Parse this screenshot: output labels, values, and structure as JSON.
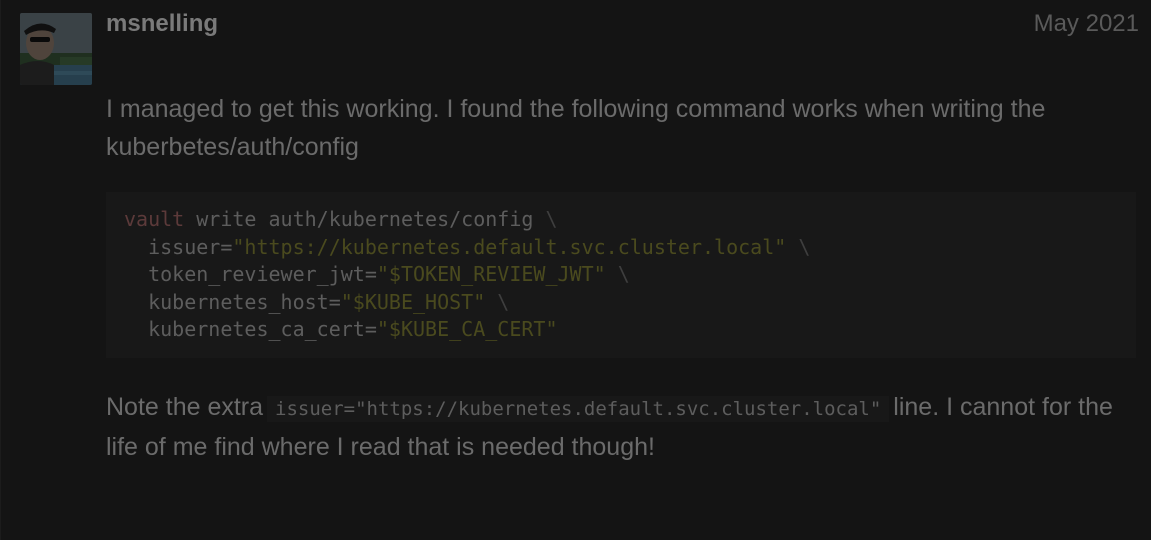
{
  "post": {
    "username": "msnelling",
    "date": "May 2021",
    "paragraph1": "I managed to get this working. I found the following command works when writing the kuberbetes/auth/config",
    "code_lines": [
      {
        "indent": "",
        "cmd": "vault",
        "text": " write auth/kubernetes/config ",
        "str": "",
        "cont": "\\"
      },
      {
        "indent": "  ",
        "cmd": "",
        "text": "issuer=",
        "str": "\"https://kubernetes.default.svc.cluster.local\"",
        "cont": " \\"
      },
      {
        "indent": "  ",
        "cmd": "",
        "text": "token_reviewer_jwt=",
        "str": "\"$TOKEN_REVIEW_JWT\"",
        "cont": " \\"
      },
      {
        "indent": "  ",
        "cmd": "",
        "text": "kubernetes_host=",
        "str": "\"$KUBE_HOST\"",
        "cont": " \\"
      },
      {
        "indent": "  ",
        "cmd": "",
        "text": "kubernetes_ca_cert=",
        "str": "\"$KUBE_CA_CERT\"",
        "cont": ""
      }
    ],
    "paragraph2_before": "Note the extra",
    "paragraph2_code": "issuer=\"https://kubernetes.default.svc.cluster.local\"",
    "paragraph2_after": "line. I cannot for the life of me find where I read that is needed though!"
  },
  "icons": {
    "avatar": "user-avatar-photo"
  },
  "colors": {
    "background": "#141414",
    "username": "#7a7a7a",
    "body_text": "#6b6b6b",
    "code_background": "#181818",
    "code_keyword": "#5c3a3a",
    "code_string": "#4a4a1e"
  }
}
